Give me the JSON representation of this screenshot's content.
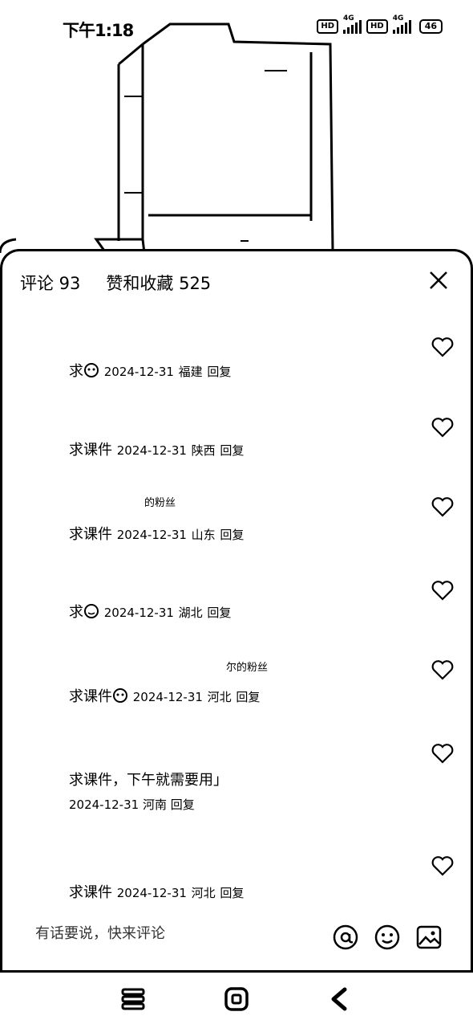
{
  "status_bar": {
    "time": "下午1:18",
    "hd1": "HD",
    "net1": "4G",
    "hd2": "HD",
    "net2": "4G",
    "battery": "46"
  },
  "sheet": {
    "tab_comments": "评论 93",
    "tab_likes": "赞和收藏 525"
  },
  "comments": [
    {
      "top": "",
      "text": "求",
      "date": "2024-12-31",
      "location": "福建",
      "reply": "回复",
      "emoji": true
    },
    {
      "top": "",
      "text": "求课件",
      "date": "2024-12-31",
      "location": "陕西",
      "reply": "回复"
    },
    {
      "top": "的粉丝",
      "text": "求课件",
      "date": "2024-12-31",
      "location": "山东",
      "reply": "回复"
    },
    {
      "top": "",
      "text": "求",
      "date": "2024-12-31",
      "location": "湖北",
      "reply": "回复",
      "emoji": true
    },
    {
      "top": "尔的粉丝",
      "text": "求课件",
      "date": "2024-12-31",
      "location": "河北",
      "reply": "回复",
      "emoji": true
    },
    {
      "top": "",
      "text": "求课件，下午就需要用」",
      "date": "2024-12-31",
      "location": "河南",
      "reply": "回复"
    },
    {
      "top": "",
      "text": "求课件",
      "date": "2024-12-31",
      "location": "河北",
      "reply": "回复"
    }
  ],
  "input": {
    "placeholder": "有话要说，快来评论"
  },
  "icons": {
    "close": "close-icon",
    "heart": "heart-icon",
    "mention": "at-icon",
    "emoji": "smiley-icon",
    "image": "image-icon",
    "nav_menu": "menu-icon",
    "nav_home": "home-icon",
    "nav_back": "back-icon"
  }
}
